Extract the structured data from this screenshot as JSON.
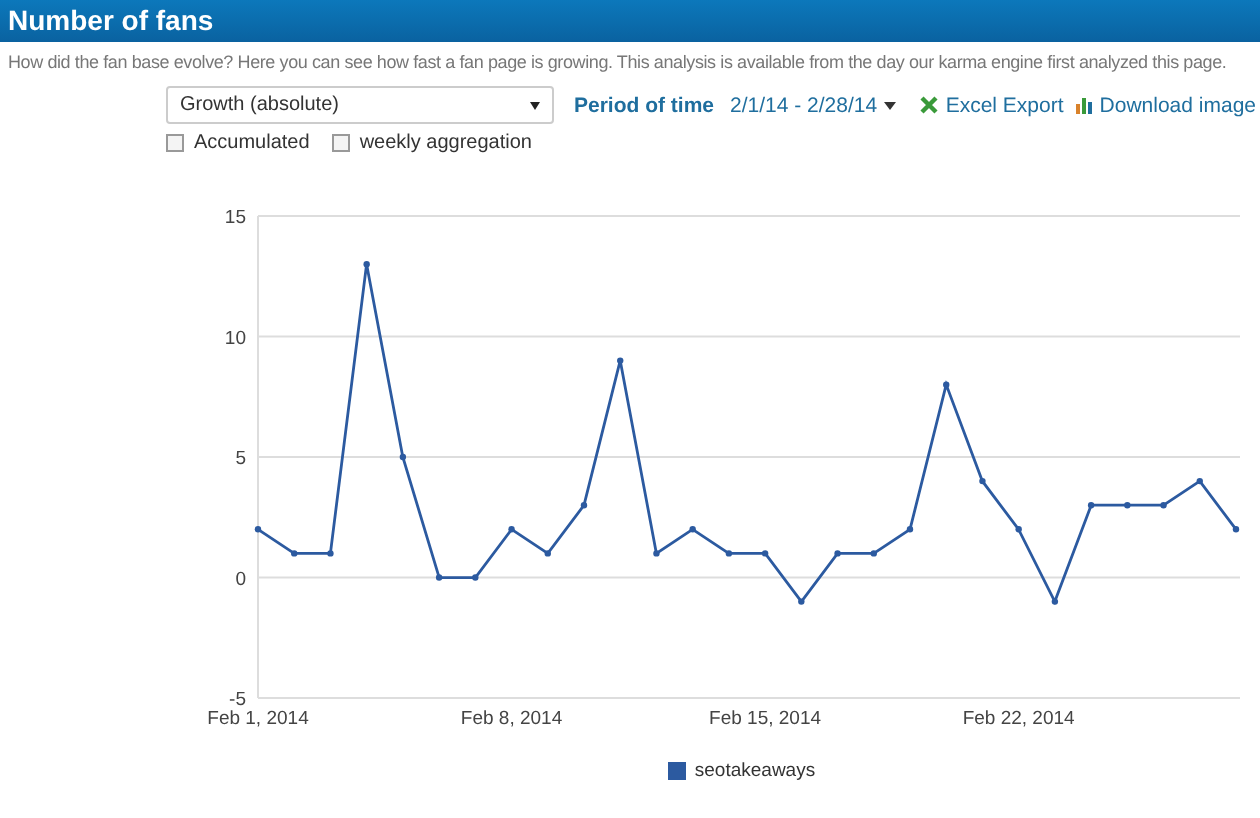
{
  "header": {
    "title": "Number of fans"
  },
  "description": "How did the fan base evolve? Here you can see how fast a fan page is growing. This analysis is available from the day our karma engine first analyzed this page.",
  "controls": {
    "metric_select": {
      "value": "Growth (absolute)"
    },
    "period_label": "Period of time",
    "period_value": "2/1/14 - 2/28/14",
    "links": [
      {
        "kind": "excel",
        "label": "Excel Export"
      },
      {
        "kind": "image",
        "label": "Download image"
      }
    ],
    "checkboxes": [
      {
        "label": "Accumulated",
        "checked": false
      },
      {
        "label": "weekly aggregation",
        "checked": false
      }
    ]
  },
  "chart": {
    "chart_data": {
      "type": "line",
      "categories": [
        "Feb 1, 2014",
        null,
        null,
        null,
        null,
        null,
        null,
        "Feb 8, 2014",
        null,
        null,
        null,
        null,
        null,
        null,
        "Feb 15, 2014",
        null,
        null,
        null,
        null,
        null,
        null,
        "Feb 22, 2014",
        null,
        null,
        null,
        null,
        null,
        null
      ],
      "grid": true,
      "series": [
        {
          "name": "seotakeaways",
          "color": "#2c5aa0",
          "marker": true,
          "values": [
            2,
            1,
            1,
            13,
            5,
            0,
            0,
            2,
            1,
            3,
            9,
            1,
            2,
            1,
            1,
            -1,
            1,
            1,
            2,
            8,
            4,
            2,
            -1,
            3,
            3,
            3,
            4,
            2
          ]
        }
      ],
      "ylim": [
        -5,
        15
      ],
      "yticks": [
        -5,
        0,
        5,
        10,
        15
      ]
    }
  }
}
